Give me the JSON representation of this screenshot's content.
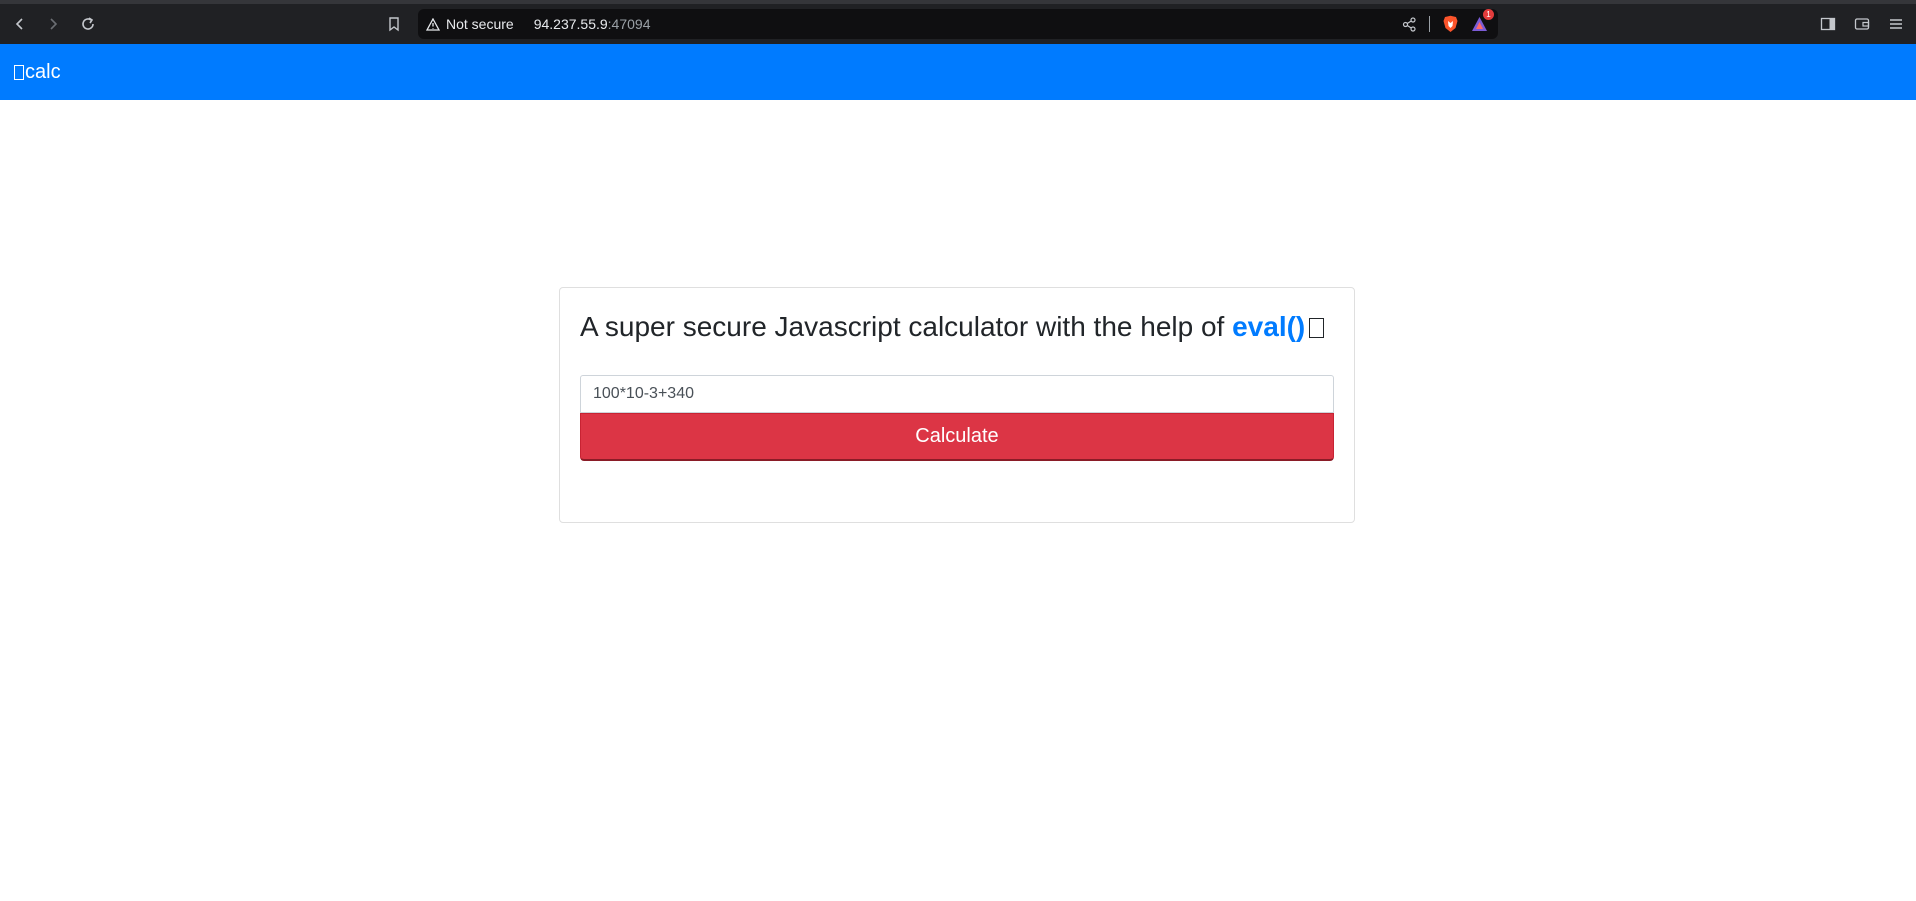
{
  "browser": {
    "not_secure_label": "Not secure",
    "url_host": "94.237.55.9",
    "url_port": ":47094",
    "notification_count": "1"
  },
  "navbar": {
    "brand_label": "calc"
  },
  "card": {
    "title_prefix": "A super secure Javascript calculator with the help of ",
    "title_highlight": "eval()",
    "expression_value": "100*10-3+340",
    "calculate_label": "Calculate"
  },
  "colors": {
    "primary": "#007bff",
    "danger": "#dc3545"
  }
}
